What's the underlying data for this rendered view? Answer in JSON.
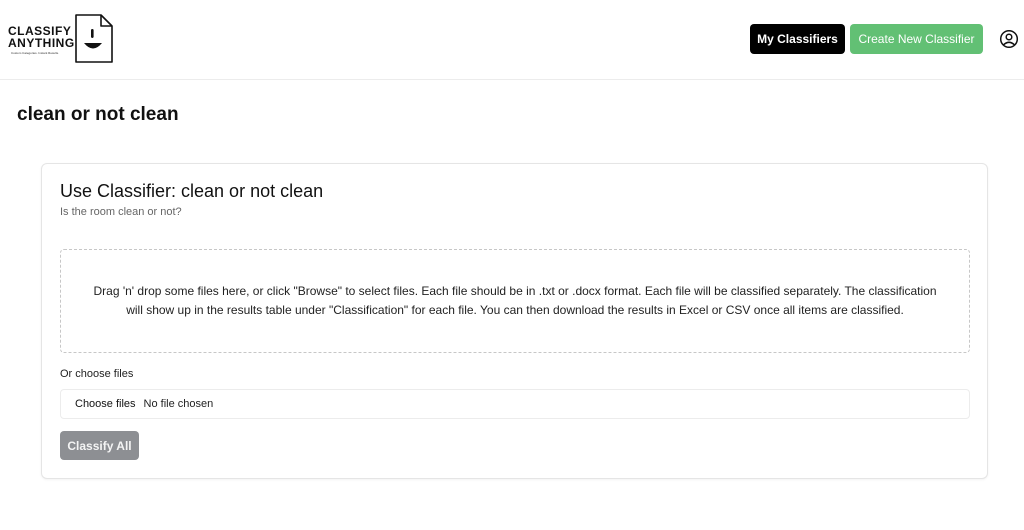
{
  "header": {
    "logo": {
      "line1": "CLASSIFY",
      "line2": "ANYTHING",
      "tagline": "Custom Categories. Instant Results."
    },
    "my_classifiers_label": "My Classifiers",
    "create_label": "Create New Classifier",
    "user_icon": "user-circle-icon"
  },
  "page": {
    "title": "clean or not clean"
  },
  "card": {
    "title": "Use Classifier: clean or not clean",
    "subtitle": "Is the room clean or not?",
    "dropzone_text": "Drag 'n' drop some files here, or click \"Browse\" to select files. Each file should be in .txt or .docx format. Each file will be classified separately. The classification will show up in the results table under \"Classification\" for each file. You can then download the results in Excel or CSV once all items are classified.",
    "choose_label": "Or choose files",
    "file_button_label": "Choose files",
    "file_status": "No file chosen",
    "classify_label": "Classify All"
  },
  "colors": {
    "primary_dark": "#000000",
    "accent_green": "#62c074",
    "disabled_gray": "#8d8f93"
  }
}
